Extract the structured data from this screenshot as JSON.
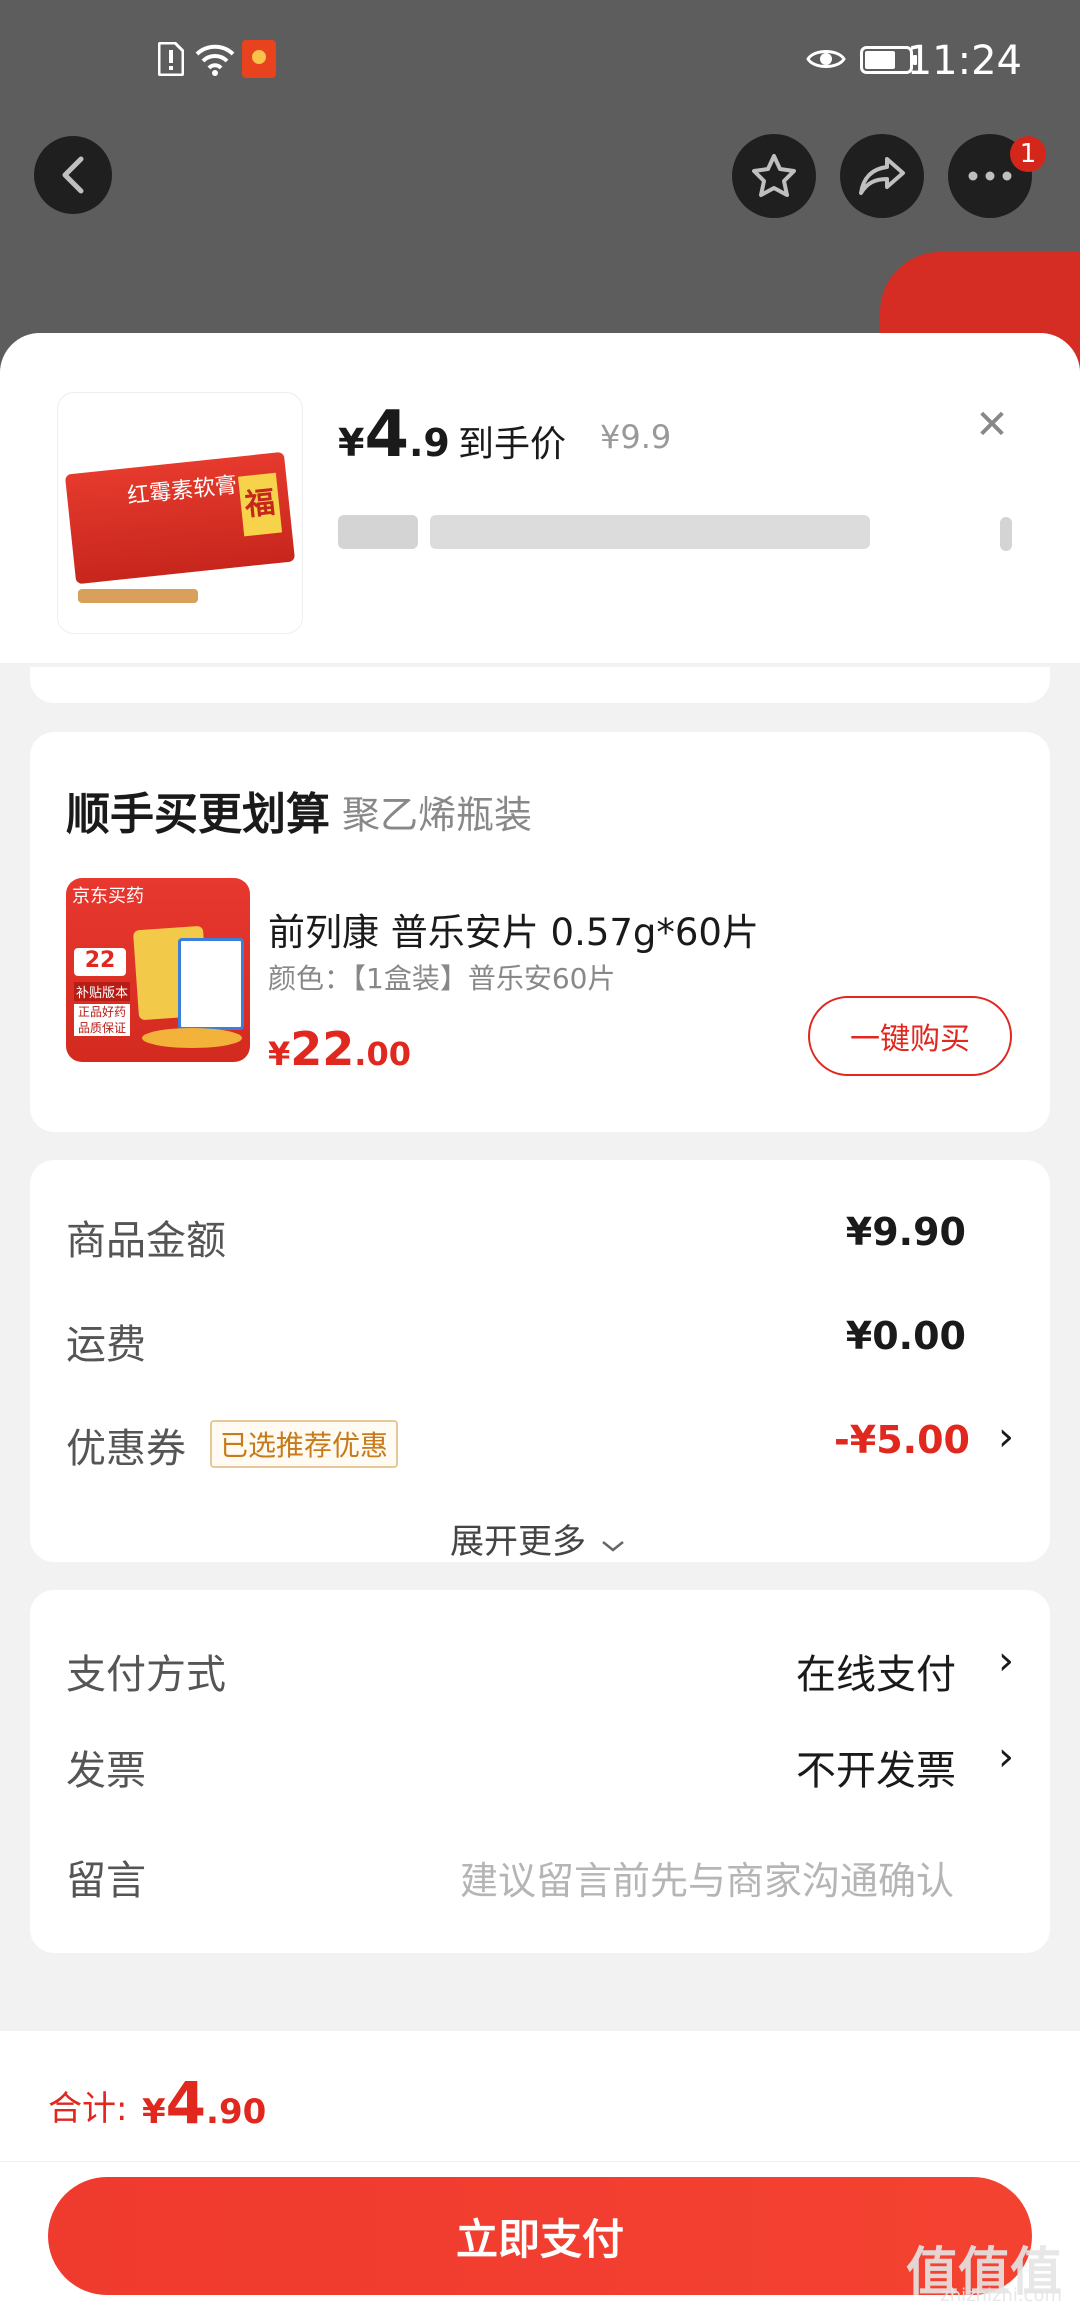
{
  "status_bar": {
    "time": "11:24",
    "sim_icon": "sim-alert-icon",
    "wifi_icon": "wifi-icon",
    "redpacket_icon": "red-packet-icon",
    "eye_icon": "eye-comfort-icon",
    "battery_icon": "battery-icon"
  },
  "nav": {
    "back_icon": "back-arrow-icon",
    "favorite_icon": "star-icon",
    "share_icon": "share-icon",
    "more_icon": "more-icon",
    "more_badge": "1"
  },
  "product": {
    "currency": "¥",
    "price_int": "4",
    "price_dec": ".9",
    "price_tag": "到手价",
    "original_price": "¥9.9",
    "image_box_label": "红霉素软膏",
    "image_box_char": "福"
  },
  "bundle": {
    "title": "顺手买更划算",
    "subtitle": "聚乙烯瓶装",
    "thumb_badge": "京东买药",
    "thumb_price": "22",
    "thumb_line1": "补贴版本",
    "thumb_line2": "正品好药 品质保证",
    "name": "前列康 普乐安片 0.57g*60片",
    "spec": "颜色：【1盒装】普乐安60片",
    "price_currency": "¥",
    "price_int": "22",
    "price_dec": ".00",
    "buy_label": "一键购买"
  },
  "summary": {
    "goods_label": "商品金额",
    "goods_value": "¥9.90",
    "shipping_label": "运费",
    "shipping_value": "¥0.00",
    "coupon_label": "优惠券",
    "coupon_tag": "已选推荐优惠",
    "coupon_value": "-¥5.00",
    "expand_label": "展开更多"
  },
  "options": {
    "payment_label": "支付方式",
    "payment_value": "在线支付",
    "invoice_label": "发票",
    "invoice_value": "不开发票",
    "note_label": "留言",
    "note_placeholder": "建议留言前先与商家沟通确认"
  },
  "footer": {
    "total_label": "合计:",
    "total_currency": "¥",
    "total_int": "4",
    "total_dec": ".90",
    "pay_label": "立即支付"
  },
  "watermark": {
    "text": "值值值",
    "sub": "zhizhizhi.com"
  },
  "colors": {
    "accent": "#e0281f",
    "coupon_tag": "#c77b1a",
    "sheet_bg": "#f2f2f2"
  }
}
